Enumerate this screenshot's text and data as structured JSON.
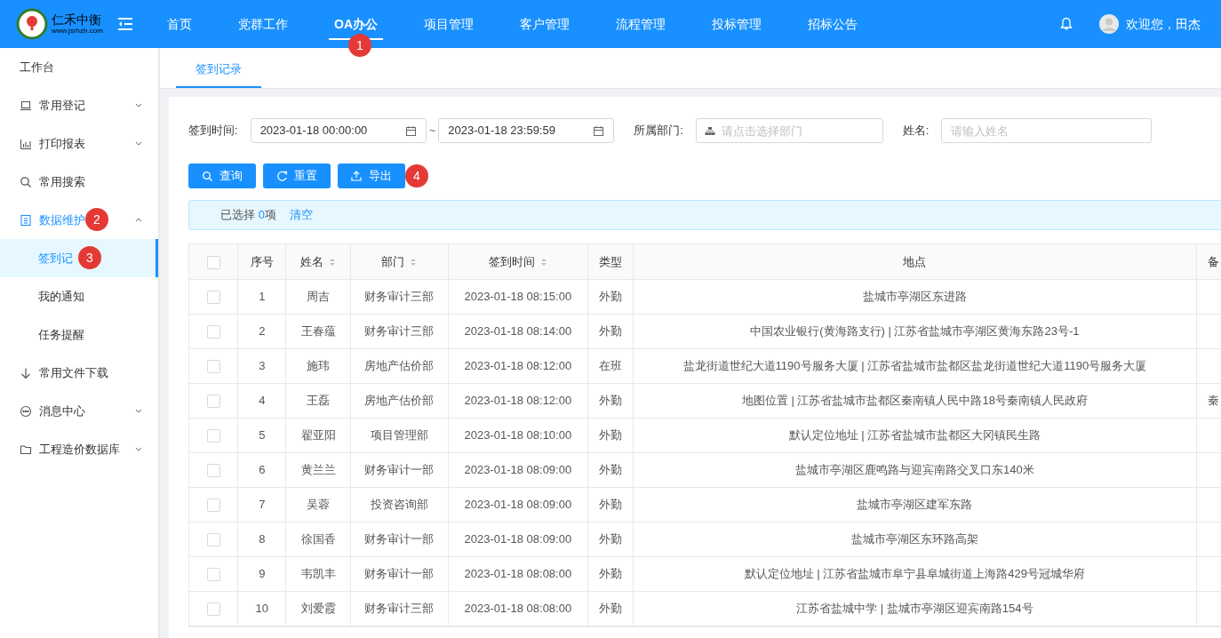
{
  "logo": {
    "name": "仁禾中衡",
    "url": "www.jsrhzh.com"
  },
  "nav": [
    {
      "label": "首页",
      "selected": false
    },
    {
      "label": "党群工作",
      "selected": false
    },
    {
      "label": "OA办公",
      "selected": true,
      "callout": "1"
    },
    {
      "label": "项目管理",
      "selected": false
    },
    {
      "label": "客户管理",
      "selected": false
    },
    {
      "label": "流程管理",
      "selected": false
    },
    {
      "label": "投标管理",
      "selected": false
    },
    {
      "label": "招标公告",
      "selected": false
    }
  ],
  "user": {
    "greeting": "欢迎您，田杰"
  },
  "sidebar": {
    "items": [
      {
        "label": "工作台",
        "kind": "plain",
        "selected": false
      },
      {
        "label": "常用登记",
        "kind": "group",
        "expanded": false,
        "selected": false
      },
      {
        "label": "打印报表",
        "kind": "group",
        "expanded": false,
        "selected": false
      },
      {
        "label": "常用搜索",
        "kind": "plain",
        "selected": false
      },
      {
        "label": "数据维护",
        "kind": "group",
        "expanded": true,
        "selected": true,
        "callout": "2",
        "children": [
          {
            "label": "签到记",
            "selected": true,
            "callout": "3"
          },
          {
            "label": "我的通知",
            "selected": false
          },
          {
            "label": "任务提醒",
            "selected": false
          }
        ]
      },
      {
        "label": "常用文件下载",
        "kind": "plain",
        "selected": false
      },
      {
        "label": "消息中心",
        "kind": "group",
        "expanded": false,
        "selected": false
      },
      {
        "label": "工程造价数据库",
        "kind": "group",
        "expanded": false,
        "selected": false
      }
    ]
  },
  "tabs": [
    {
      "label": "签到记录",
      "selected": true
    }
  ],
  "filters": {
    "time": {
      "label": "签到时间:",
      "start": "2023-01-18 00:00:00",
      "separator": "~",
      "end": "2023-01-18 23:59:59"
    },
    "department": {
      "label": "所属部门:",
      "placeholder": "请点击选择部门"
    },
    "name": {
      "label": "姓名:",
      "placeholder": "请输入姓名"
    }
  },
  "buttons": [
    {
      "label": "查询"
    },
    {
      "label": "重置"
    },
    {
      "label": "导出",
      "callout": "4"
    }
  ],
  "selection": {
    "prefix": "已选择",
    "count": "0",
    "suffix": "项",
    "clear": "清空"
  },
  "table": {
    "select_all": {
      "checked": false
    },
    "columns": [
      {
        "label": "序号",
        "sortable": false
      },
      {
        "label": "姓名",
        "sortable": true
      },
      {
        "label": "部门",
        "sortable": true
      },
      {
        "label": "签到时间",
        "sortable": true
      },
      {
        "label": "类型",
        "sortable": false
      },
      {
        "label": "地点",
        "sortable": false
      },
      {
        "label": "备"
      }
    ],
    "rows": [
      {
        "checked": false,
        "cells": [
          "1",
          "周吉",
          "财务审计三部",
          "2023-01-18 08:15:00",
          "外勤",
          "盐城市亭湖区东进路"
        ]
      },
      {
        "checked": false,
        "cells": [
          "2",
          "王春蕴",
          "财务审计三部",
          "2023-01-18 08:14:00",
          "外勤",
          "中国农业银行(黄海路支行) | 江苏省盐城市亭湖区黄海东路23号-1"
        ]
      },
      {
        "checked": false,
        "cells": [
          "3",
          "施玮",
          "房地产估价部",
          "2023-01-18 08:12:00",
          "在班",
          "盐龙街道世纪大道1190号服务大厦 | 江苏省盐城市盐都区盐龙街道世纪大道1190号服务大厦"
        ]
      },
      {
        "checked": false,
        "cells": [
          "4",
          "王磊",
          "房地产估价部",
          "2023-01-18 08:12:00",
          "外勤",
          "地图位置 | 江苏省盐城市盐都区秦南镇人民中路18号秦南镇人民政府",
          "秦"
        ]
      },
      {
        "checked": false,
        "cells": [
          "5",
          "翟亚阳",
          "项目管理部",
          "2023-01-18 08:10:00",
          "外勤",
          "默认定位地址 | 江苏省盐城市盐都区大冈镇民生路"
        ]
      },
      {
        "checked": false,
        "cells": [
          "6",
          "黄兰兰",
          "财务审计一部",
          "2023-01-18 08:09:00",
          "外勤",
          "盐城市亭湖区鹿鸣路与迎宾南路交叉口东140米"
        ]
      },
      {
        "checked": false,
        "cells": [
          "7",
          "吴蓉",
          "投资咨询部",
          "2023-01-18 08:09:00",
          "外勤",
          "盐城市亭湖区建军东路"
        ]
      },
      {
        "checked": false,
        "cells": [
          "8",
          "徐国香",
          "财务审计一部",
          "2023-01-18 08:09:00",
          "外勤",
          "盐城市亭湖区东环路高架"
        ]
      },
      {
        "checked": false,
        "cells": [
          "9",
          "韦凯丰",
          "财务审计一部",
          "2023-01-18 08:08:00",
          "外勤",
          "默认定位地址 | 江苏省盐城市阜宁县阜城街道上海路429号冠城华府"
        ]
      },
      {
        "checked": false,
        "cells": [
          "10",
          "刘爱霞",
          "财务审计三部",
          "2023-01-18 08:08:00",
          "外勤",
          "江苏省盐城中学 | 盐城市亭湖区迎宾南路154号"
        ]
      }
    ]
  }
}
